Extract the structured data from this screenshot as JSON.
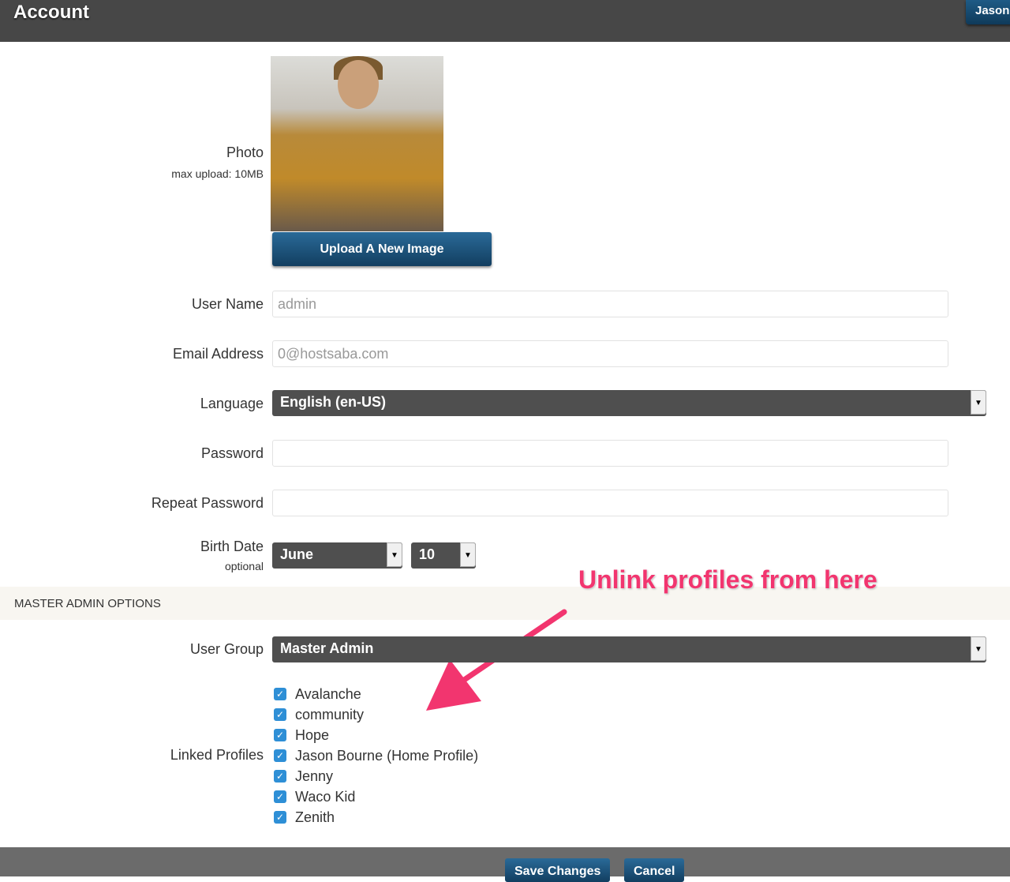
{
  "header": {
    "title": "Account",
    "user_button": "Jason"
  },
  "photo": {
    "label": "Photo",
    "hint": "max upload: 10MB",
    "upload_button": "Upload A New Image"
  },
  "fields": {
    "username": {
      "label": "User Name",
      "value": "admin"
    },
    "email": {
      "label": "Email Address",
      "value": "0@hostsaba.com"
    },
    "language": {
      "label": "Language",
      "value": "English (en-US)"
    },
    "password": {
      "label": "Password",
      "value": ""
    },
    "repeat_password": {
      "label": "Repeat Password",
      "value": ""
    },
    "birth_date": {
      "label": "Birth Date",
      "hint": "optional",
      "month": "June",
      "day": "10"
    }
  },
  "section": {
    "title": "MASTER ADMIN OPTIONS"
  },
  "user_group": {
    "label": "User Group",
    "value": "Master Admin"
  },
  "linked_profiles": {
    "label": "Linked Profiles",
    "items": [
      "Avalanche",
      "community",
      "Hope",
      "Jason Bourne (Home Profile)",
      "Jenny",
      "Waco Kid",
      "Zenith"
    ]
  },
  "annotation": "Unlink profiles from here",
  "footer": {
    "save": "Save Changes",
    "cancel": "Cancel"
  },
  "colors": {
    "annotation": "#f2356f",
    "button": "#1e5b86",
    "checkbox": "#2e8fd6"
  }
}
